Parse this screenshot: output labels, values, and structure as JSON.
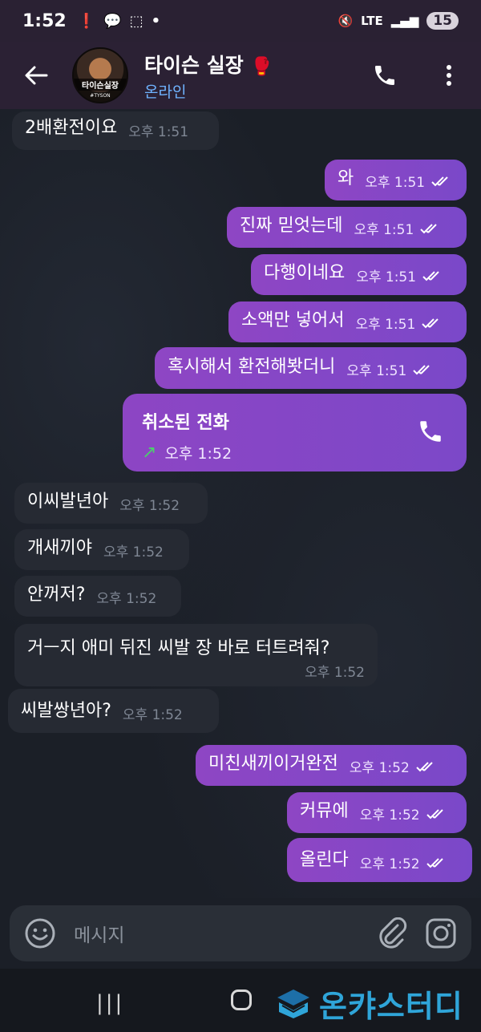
{
  "status_bar": {
    "time": "1:52",
    "battery": "15",
    "network": "LTE"
  },
  "header": {
    "contact_name": "타이슨 실장",
    "status": "온라인",
    "avatar_text": "타이슨실장",
    "avatar_subtext": "#TYSON"
  },
  "messages": [
    {
      "direction": "in",
      "text": "2배환전이요",
      "time": "오후 1:51"
    },
    {
      "direction": "out",
      "text": "와",
      "time": "오후 1:51"
    },
    {
      "direction": "out",
      "text": "진짜 믿엇는데",
      "time": "오후 1:51"
    },
    {
      "direction": "out",
      "text": "다행이네요",
      "time": "오후 1:51"
    },
    {
      "direction": "out",
      "text": "소액만 넣어서",
      "time": "오후 1:51"
    },
    {
      "direction": "out",
      "text": "혹시해서 환전해봣더니",
      "time": "오후 1:51"
    },
    {
      "direction": "in",
      "text": "이씨발년아",
      "time": "오후 1:52"
    },
    {
      "direction": "in",
      "text": "개새끼야",
      "time": "오후 1:52"
    },
    {
      "direction": "in",
      "text": "안꺼저?",
      "time": "오후 1:52"
    },
    {
      "direction": "in",
      "text": "거ㅡ지 애미 뒤진 씨발 장 바로 터트려줘?",
      "time": "오후 1:52"
    },
    {
      "direction": "in",
      "text": "씨발쌍년아?",
      "time": "오후 1:52"
    },
    {
      "direction": "out",
      "text": "미친새끼이거완전",
      "time": "오후 1:52"
    },
    {
      "direction": "out",
      "text": "커뮤에",
      "time": "오후 1:52"
    },
    {
      "direction": "out",
      "text": "올린다",
      "time": "오후 1:52"
    }
  ],
  "call": {
    "title": "취소된 전화",
    "time": "오후 1:52"
  },
  "input": {
    "placeholder": "메시지"
  },
  "watermark": {
    "text": "온캬스터디"
  },
  "colors": {
    "outgoing_bubble": "#8a46c6",
    "incoming_bubble": "#262a33",
    "header_bg": "#2b2134",
    "online_status": "#6fb3ff",
    "call_arrow": "#4ccf6c",
    "watermark": "#2fa5d9"
  }
}
